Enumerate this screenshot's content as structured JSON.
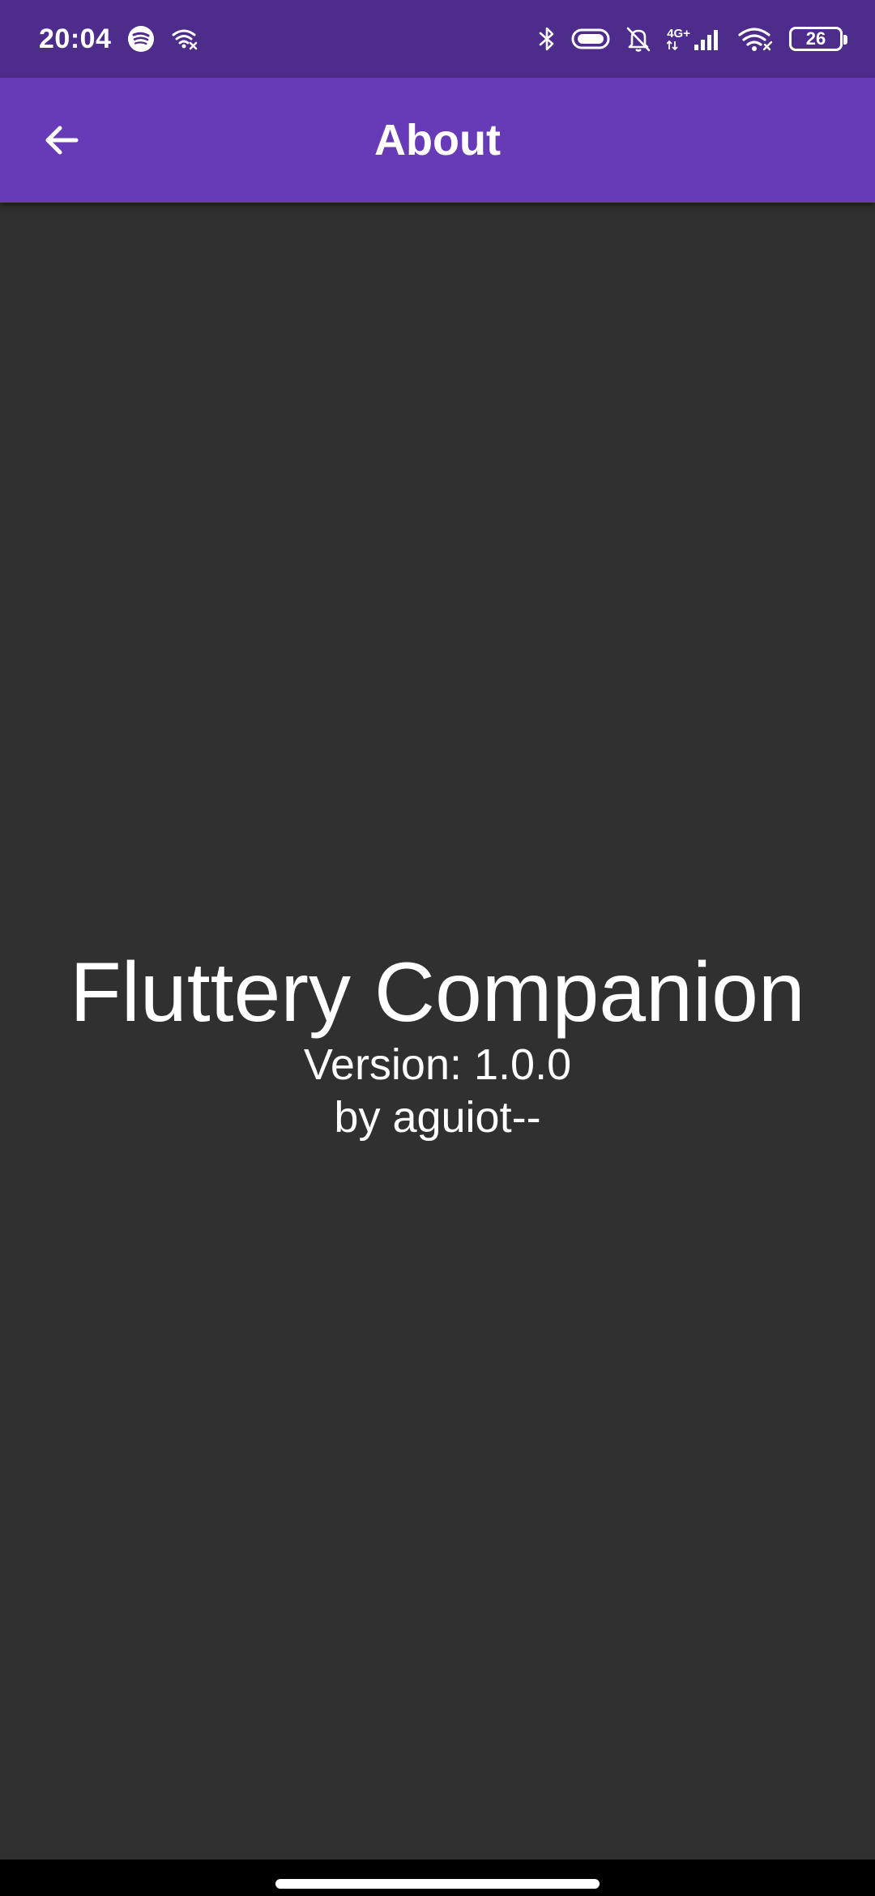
{
  "status_bar": {
    "time": "20:04",
    "network_label": "4G+",
    "battery_level": "26",
    "icons": [
      "spotify-icon",
      "wifi-calling-icon",
      "bluetooth-icon",
      "vpn-icon",
      "notifications-off-icon",
      "signal-icon",
      "wifi-icon",
      "battery-icon"
    ]
  },
  "app_bar": {
    "title": "About",
    "back_icon": "arrow-back-icon"
  },
  "about": {
    "app_name": "Fluttery Companion",
    "version": "Version: 1.0.0",
    "author": "by aguiot--"
  },
  "colors": {
    "status_bar_bg": "#4e2c8c",
    "app_bar_bg": "#673ab7",
    "page_bg": "#303030",
    "nav_bar_bg": "#000000",
    "text": "#ffffff"
  }
}
